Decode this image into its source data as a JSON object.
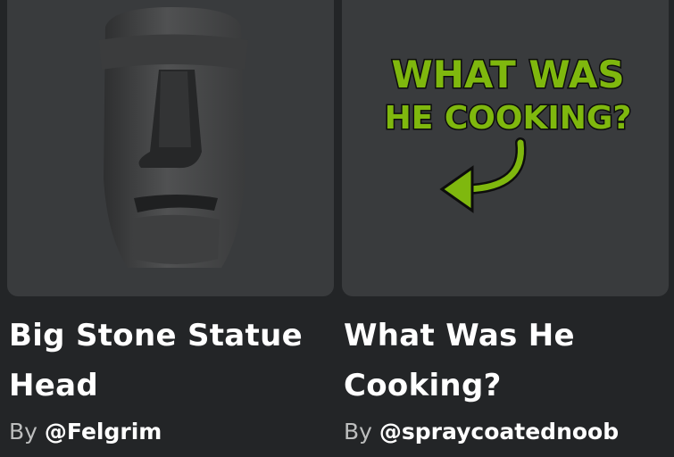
{
  "items": [
    {
      "title": "Big Stone Statue Head",
      "by_label": "By",
      "creator": "@Felgrim",
      "thumbnail_icon": "stone-head-thumbnail"
    },
    {
      "title": "What Was He Cooking?",
      "by_label": "By",
      "creator": "@spraycoatednoob",
      "thumbnail_text_line1": "WHAT WAS",
      "thumbnail_text_line2": "HE COOKING?",
      "thumbnail_icon": "curved-arrow-icon",
      "accent_color": "#7fb80e"
    }
  ]
}
